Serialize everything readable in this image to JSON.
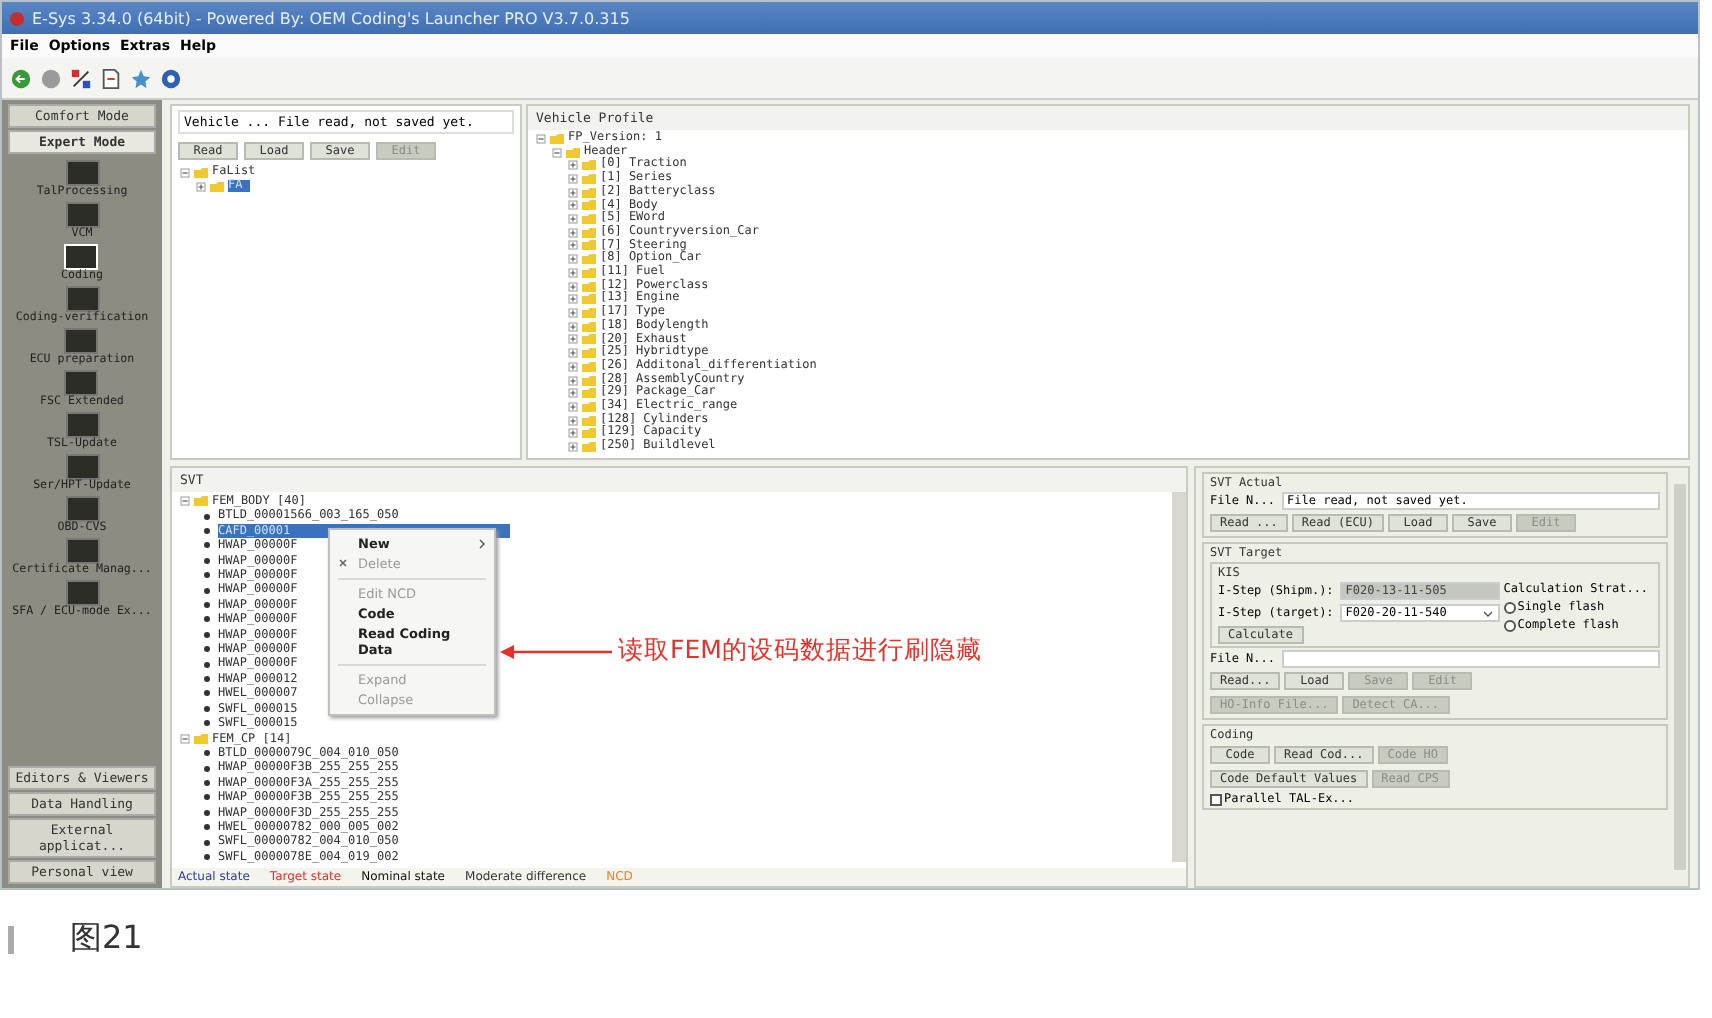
{
  "window": {
    "title": "E-Sys 3.34.0  (64bit) - Powered By: OEM Coding's Launcher PRO V3.7.0.315"
  },
  "menu": [
    "File",
    "Options",
    "Extras",
    "Help"
  ],
  "sidebar": {
    "modes": [
      {
        "label": "Comfort Mode",
        "selected": false
      },
      {
        "label": "Expert Mode",
        "selected": true
      }
    ],
    "items": [
      {
        "label": "TalProcessing",
        "selected": false
      },
      {
        "label": "VCM",
        "selected": false
      },
      {
        "label": "Coding",
        "selected": true
      },
      {
        "label": "Coding-verification",
        "selected": false
      },
      {
        "label": "ECU preparation",
        "selected": false
      },
      {
        "label": "FSC Extended",
        "selected": false
      },
      {
        "label": "TSL-Update",
        "selected": false
      },
      {
        "label": "Ser/HPT-Update",
        "selected": false
      },
      {
        "label": "OBD-CVS",
        "selected": false
      },
      {
        "label": "Certificate Manag...",
        "selected": false
      },
      {
        "label": "SFA / ECU-mode Ex...",
        "selected": false
      }
    ],
    "bottom": [
      "Editors & Viewers",
      "Data Handling",
      "External applicat...",
      "Personal view"
    ]
  },
  "vehicle": {
    "label": "Vehicle ...",
    "status": "File read, not saved yet.",
    "buttons": [
      {
        "label": "Read",
        "disabled": false
      },
      {
        "label": "Load",
        "disabled": false
      },
      {
        "label": "Save",
        "disabled": false
      },
      {
        "label": "Edit",
        "disabled": true
      }
    ],
    "tree": [
      {
        "label": "FaList",
        "kind": "folder",
        "expanded": true,
        "selected": false,
        "children": [
          {
            "label": "FA",
            "kind": "folder",
            "expanded": false,
            "selected": true
          }
        ]
      }
    ]
  },
  "profile": {
    "title": "Vehicle Profile",
    "tree": [
      {
        "label": "FP_Version: 1",
        "kind": "folder",
        "expanded": true,
        "selected": false,
        "children": [
          {
            "label": "Header",
            "kind": "folder",
            "expanded": true,
            "selected": false,
            "children": [
              {
                "label": "[0]  Traction",
                "kind": "folder",
                "expanded": false,
                "selected": false
              },
              {
                "label": "[1]  Series",
                "kind": "folder",
                "expanded": false,
                "selected": false
              },
              {
                "label": "[2]  Batteryclass",
                "kind": "folder",
                "expanded": false,
                "selected": false
              },
              {
                "label": "[4]  Body",
                "kind": "folder",
                "expanded": false,
                "selected": false
              },
              {
                "label": "[5]  EWord",
                "kind": "folder",
                "expanded": false,
                "selected": false
              },
              {
                "label": "[6]  Countryversion_Car",
                "kind": "folder",
                "expanded": false,
                "selected": false
              },
              {
                "label": "[7]  Steering",
                "kind": "folder",
                "expanded": false,
                "selected": false
              },
              {
                "label": "[8]  Option_Car",
                "kind": "folder",
                "expanded": false,
                "selected": false
              },
              {
                "label": "[11]  Fuel",
                "kind": "folder",
                "expanded": false,
                "selected": false
              },
              {
                "label": "[12]  Powerclass",
                "kind": "folder",
                "expanded": false,
                "selected": false
              },
              {
                "label": "[13]  Engine",
                "kind": "folder",
                "expanded": false,
                "selected": false
              },
              {
                "label": "[17]  Type",
                "kind": "folder",
                "expanded": false,
                "selected": false
              },
              {
                "label": "[18]  Bodylength",
                "kind": "folder",
                "expanded": false,
                "selected": false
              },
              {
                "label": "[20]  Exhaust",
                "kind": "folder",
                "expanded": false,
                "selected": false
              },
              {
                "label": "[25]  Hybridtype",
                "kind": "folder",
                "expanded": false,
                "selected": false
              },
              {
                "label": "[26]  Additonal_differentiation",
                "kind": "folder",
                "expanded": false,
                "selected": false
              },
              {
                "label": "[28]  AssemblyCountry",
                "kind": "folder",
                "expanded": false,
                "selected": false
              },
              {
                "label": "[29]  Package_Car",
                "kind": "folder",
                "expanded": false,
                "selected": false
              },
              {
                "label": "[34]  Electric_range",
                "kind": "folder",
                "expanded": false,
                "selected": false
              },
              {
                "label": "[128]  Cylinders",
                "kind": "folder",
                "expanded": false,
                "selected": false
              },
              {
                "label": "[129]  Capacity",
                "kind": "folder",
                "expanded": false,
                "selected": false
              },
              {
                "label": "[250]  Buildlevel",
                "kind": "folder",
                "expanded": false,
                "selected": false
              }
            ]
          }
        ]
      }
    ]
  },
  "svt": {
    "title": "SVT",
    "tree": [
      {
        "label": "FEM_BODY  [40]",
        "kind": "folder",
        "expanded": true,
        "selected": false,
        "children": [
          {
            "label": "BTLD_00001566_003_165_050",
            "kind": "leaf",
            "selected": false
          },
          {
            "label": "CAFD_00001",
            "kind": "leaf",
            "selected": true
          },
          {
            "label": "HWAP_00000F",
            "kind": "leaf",
            "selected": false
          },
          {
            "label": "HWAP_00000F",
            "kind": "leaf",
            "selected": false
          },
          {
            "label": "HWAP_00000F",
            "kind": "leaf",
            "selected": false
          },
          {
            "label": "HWAP_00000F",
            "kind": "leaf",
            "selected": false
          },
          {
            "label": "HWAP_00000F",
            "kind": "leaf",
            "selected": false
          },
          {
            "label": "HWAP_00000F",
            "kind": "leaf",
            "selected": false
          },
          {
            "label": "HWAP_00000F",
            "kind": "leaf",
            "selected": false
          },
          {
            "label": "HWAP_00000F",
            "kind": "leaf",
            "selected": false
          },
          {
            "label": "HWAP_00000F",
            "kind": "leaf",
            "selected": false
          },
          {
            "label": "HWAP_000012",
            "kind": "leaf",
            "selected": false
          },
          {
            "label": "HWEL_000007",
            "kind": "leaf",
            "selected": false
          },
          {
            "label": "SWFL_000015",
            "kind": "leaf",
            "selected": false
          },
          {
            "label": "SWFL_000015",
            "kind": "leaf",
            "selected": false
          }
        ]
      },
      {
        "label": "FEM_CP  [14]",
        "kind": "folder",
        "expanded": true,
        "selected": false,
        "children": [
          {
            "label": "BTLD_0000079C_004_010_050",
            "kind": "leaf",
            "selected": false
          },
          {
            "label": "HWAP_00000F3B_255_255_255",
            "kind": "leaf",
            "selected": false
          },
          {
            "label": "HWAP_00000F3A_255_255_255",
            "kind": "leaf",
            "selected": false
          },
          {
            "label": "HWAP_00000F3B_255_255_255",
            "kind": "leaf",
            "selected": false
          },
          {
            "label": "HWAP_00000F3D_255_255_255",
            "kind": "leaf",
            "selected": false
          },
          {
            "label": "HWEL_00000782_000_005_002",
            "kind": "leaf",
            "selected": false
          },
          {
            "label": "SWFL_00000782_004_010_050",
            "kind": "leaf",
            "selected": false
          },
          {
            "label": "SWFL_0000078E_004_019_002",
            "kind": "leaf",
            "selected": false
          }
        ]
      }
    ],
    "context_menu": [
      {
        "kind": "submenu",
        "label": "New",
        "disabled": false
      },
      {
        "kind": "icon-item",
        "label": "Delete",
        "disabled": true
      },
      {
        "kind": "separator"
      },
      {
        "kind": "item",
        "label": "Edit NCD",
        "disabled": true
      },
      {
        "kind": "item",
        "label": "Code",
        "disabled": false
      },
      {
        "kind": "item",
        "label": "Read Coding Data",
        "disabled": false
      },
      {
        "kind": "separator"
      },
      {
        "kind": "item",
        "label": "Expand",
        "disabled": true
      },
      {
        "kind": "item",
        "label": "Collapse",
        "disabled": true
      }
    ],
    "annotation": "读取FEM的设码数据进行刷隐藏",
    "legend": [
      {
        "label": "Actual state",
        "color": "#2a3f9a"
      },
      {
        "label": "Target state",
        "color": "#e0302a"
      },
      {
        "label": "Nominal state",
        "color": "#111111"
      },
      {
        "label": "Moderate difference",
        "color": "#333333"
      },
      {
        "label": "NCD",
        "color": "#f08020"
      }
    ]
  },
  "svt_actual": {
    "title": "SVT Actual",
    "file_label": "File N...",
    "file_status": "File read, not saved yet.",
    "buttons": [
      {
        "label": "Read ...",
        "disabled": false
      },
      {
        "label": "Read (ECU)",
        "disabled": false
      },
      {
        "label": "Load",
        "disabled": false
      },
      {
        "label": "Save",
        "disabled": false
      },
      {
        "label": "Edit",
        "disabled": true
      }
    ]
  },
  "svt_target": {
    "title": "SVT Target",
    "kis": {
      "title": "KIS",
      "shipment_label": "I-Step (Shipm.):",
      "shipment_value": "F020-13-11-505",
      "target_label": "I-Step (target):",
      "target_value": "F020-20-11-540",
      "calculate": "Calculate",
      "strategy_label": "Calculation Strat...",
      "options": [
        {
          "label": "Single flash",
          "selected": false
        },
        {
          "label": "Complete flash",
          "selected": false
        }
      ]
    },
    "file_label": "File N...",
    "buttons": [
      {
        "label": "Read...",
        "disabled": false
      },
      {
        "label": "Load",
        "disabled": false
      },
      {
        "label": "Save",
        "disabled": true
      },
      {
        "label": "Edit",
        "disabled": true
      }
    ],
    "buttons2": [
      {
        "label": "HO-Info File...",
        "disabled": true
      },
      {
        "label": "Detect CA...",
        "disabled": true
      }
    ]
  },
  "coding": {
    "title": "Coding",
    "buttons": [
      {
        "label": "Code",
        "disabled": false
      },
      {
        "label": "Read Cod...",
        "disabled": false
      },
      {
        "label": "Code HO",
        "disabled": true
      }
    ],
    "buttons2": [
      {
        "label": "Code Default Values",
        "disabled": false
      },
      {
        "label": "Read CPS",
        "disabled": true
      }
    ],
    "parallel": {
      "label": "Parallel TAL-Ex...",
      "checked": false
    }
  },
  "caption": "图21"
}
